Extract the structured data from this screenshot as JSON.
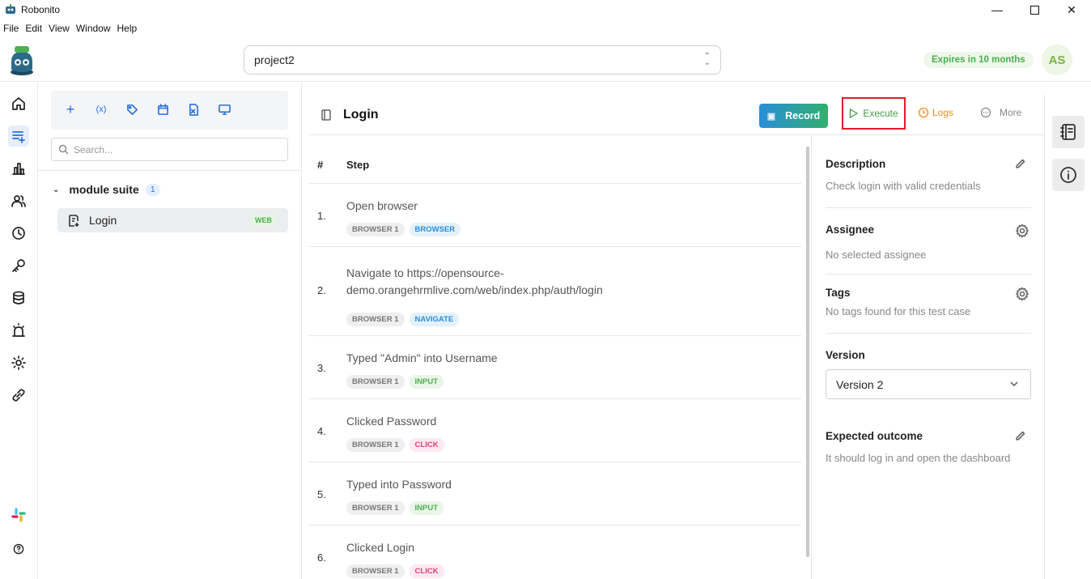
{
  "window": {
    "title": "Robonito"
  },
  "menu": [
    "File",
    "Edit",
    "View",
    "Window",
    "Help"
  ],
  "header": {
    "project": "project2",
    "expires": "Expires in 10 months",
    "avatar": "AS"
  },
  "leftnav": {
    "items": [
      "home-icon",
      "test-cases-icon",
      "reports-icon",
      "users-icon",
      "history-icon",
      "key-icon",
      "database-icon",
      "alerts-icon",
      "settings-icon",
      "integrations-icon"
    ],
    "bottom": [
      "slack-icon",
      "help-icon"
    ]
  },
  "suite_panel": {
    "search_placeholder": "Search...",
    "module": {
      "name": "module suite",
      "count": "1"
    },
    "testcase": {
      "name": "Login",
      "badge": "WEB"
    }
  },
  "testcase": {
    "title": "Login",
    "record_label": "Record",
    "execute_label": "Execute",
    "logs_label": "Logs",
    "more_label": "More"
  },
  "steps": {
    "col_num": "#",
    "col_step": "Step",
    "rows": [
      {
        "num": "1.",
        "text": "Open browser",
        "tags": [
          "BROWSER 1",
          "BROWSER"
        ]
      },
      {
        "num": "2.",
        "text": "Navigate to https://opensource-demo.orangehrmlive.com/web/index.php/auth/login",
        "tags": [
          "BROWSER 1",
          "NAVIGATE"
        ]
      },
      {
        "num": "3.",
        "text": "Typed \"Admin\" into Username",
        "tags": [
          "BROWSER 1",
          "INPUT"
        ]
      },
      {
        "num": "4.",
        "text": "Clicked Password",
        "tags": [
          "BROWSER 1",
          "CLICK"
        ]
      },
      {
        "num": "5.",
        "text": "Typed into Password",
        "tags": [
          "BROWSER 1",
          "INPUT"
        ]
      },
      {
        "num": "6.",
        "text": "Clicked Login",
        "tags": [
          "BROWSER 1",
          "CLICK"
        ]
      }
    ]
  },
  "details": {
    "description_label": "Description",
    "description_value": "Check login with valid credentials",
    "assignee_label": "Assignee",
    "assignee_value": "No selected assignee",
    "tags_label": "Tags",
    "tags_value": "No tags found for this test case",
    "version_label": "Version",
    "version_value": "Version 2",
    "outcome_label": "Expected outcome",
    "outcome_value": "It should log in and open the dashboard"
  },
  "colors": {
    "accent": "#2a6fdb",
    "execute_border": "#e21b2b",
    "green": "#4caf50",
    "logs": "#f28a1e"
  }
}
